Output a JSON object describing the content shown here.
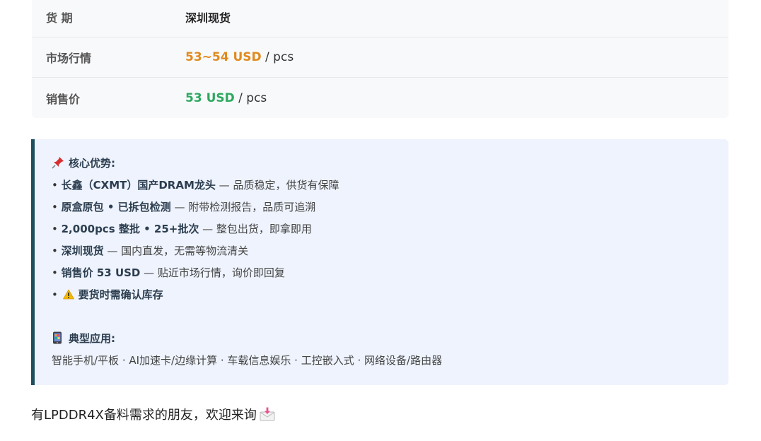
{
  "spec_table": {
    "rows": [
      {
        "label": "货 期",
        "value": "深圳现货"
      },
      {
        "label": "市场行情",
        "price": "53~54 USD",
        "unit": " / pcs",
        "color": "#e08a1e"
      },
      {
        "label": "销售价",
        "price": "53 USD",
        "unit": " / pcs",
        "color": "#2ea860"
      }
    ]
  },
  "advantages": {
    "icon": "pushpin-icon",
    "title": "核心优势:",
    "items": [
      {
        "bullet": "• ",
        "strong": "长鑫（CXMT）国产DRAM龙头",
        "rest": " — 品质稳定，供货有保障"
      },
      {
        "bullet": "• ",
        "strong": "原盒原包 • 已拆包检测",
        "rest": " — 附带检测报告，品质可追溯"
      },
      {
        "bullet": "• ",
        "strong": "2,000pcs 整批 • 25+批次",
        "rest": " — 整包出货，即拿即用"
      },
      {
        "bullet": "• ",
        "strong": "深圳现货",
        "rest": " — 国内直发，无需等物流清关"
      },
      {
        "bullet": "• ",
        "strong": "销售价 53 USD",
        "rest": " — 贴近市场行情，询价即回复"
      },
      {
        "bullet": "• ",
        "strong": "要货时需确认库存",
        "rest": "",
        "icon": "warning-icon"
      }
    ]
  },
  "applications": {
    "icon": "mobile-phone-icon",
    "title": "典型应用:",
    "text": "智能手机/平板 · AI加速卡/边缘计算 · 车载信息娱乐 · 工控嵌入式 · 网络设备/路由器"
  },
  "footer": {
    "text": "有LPDDR4X备料需求的朋友，欢迎来询",
    "icon": "incoming-envelope-icon"
  }
}
